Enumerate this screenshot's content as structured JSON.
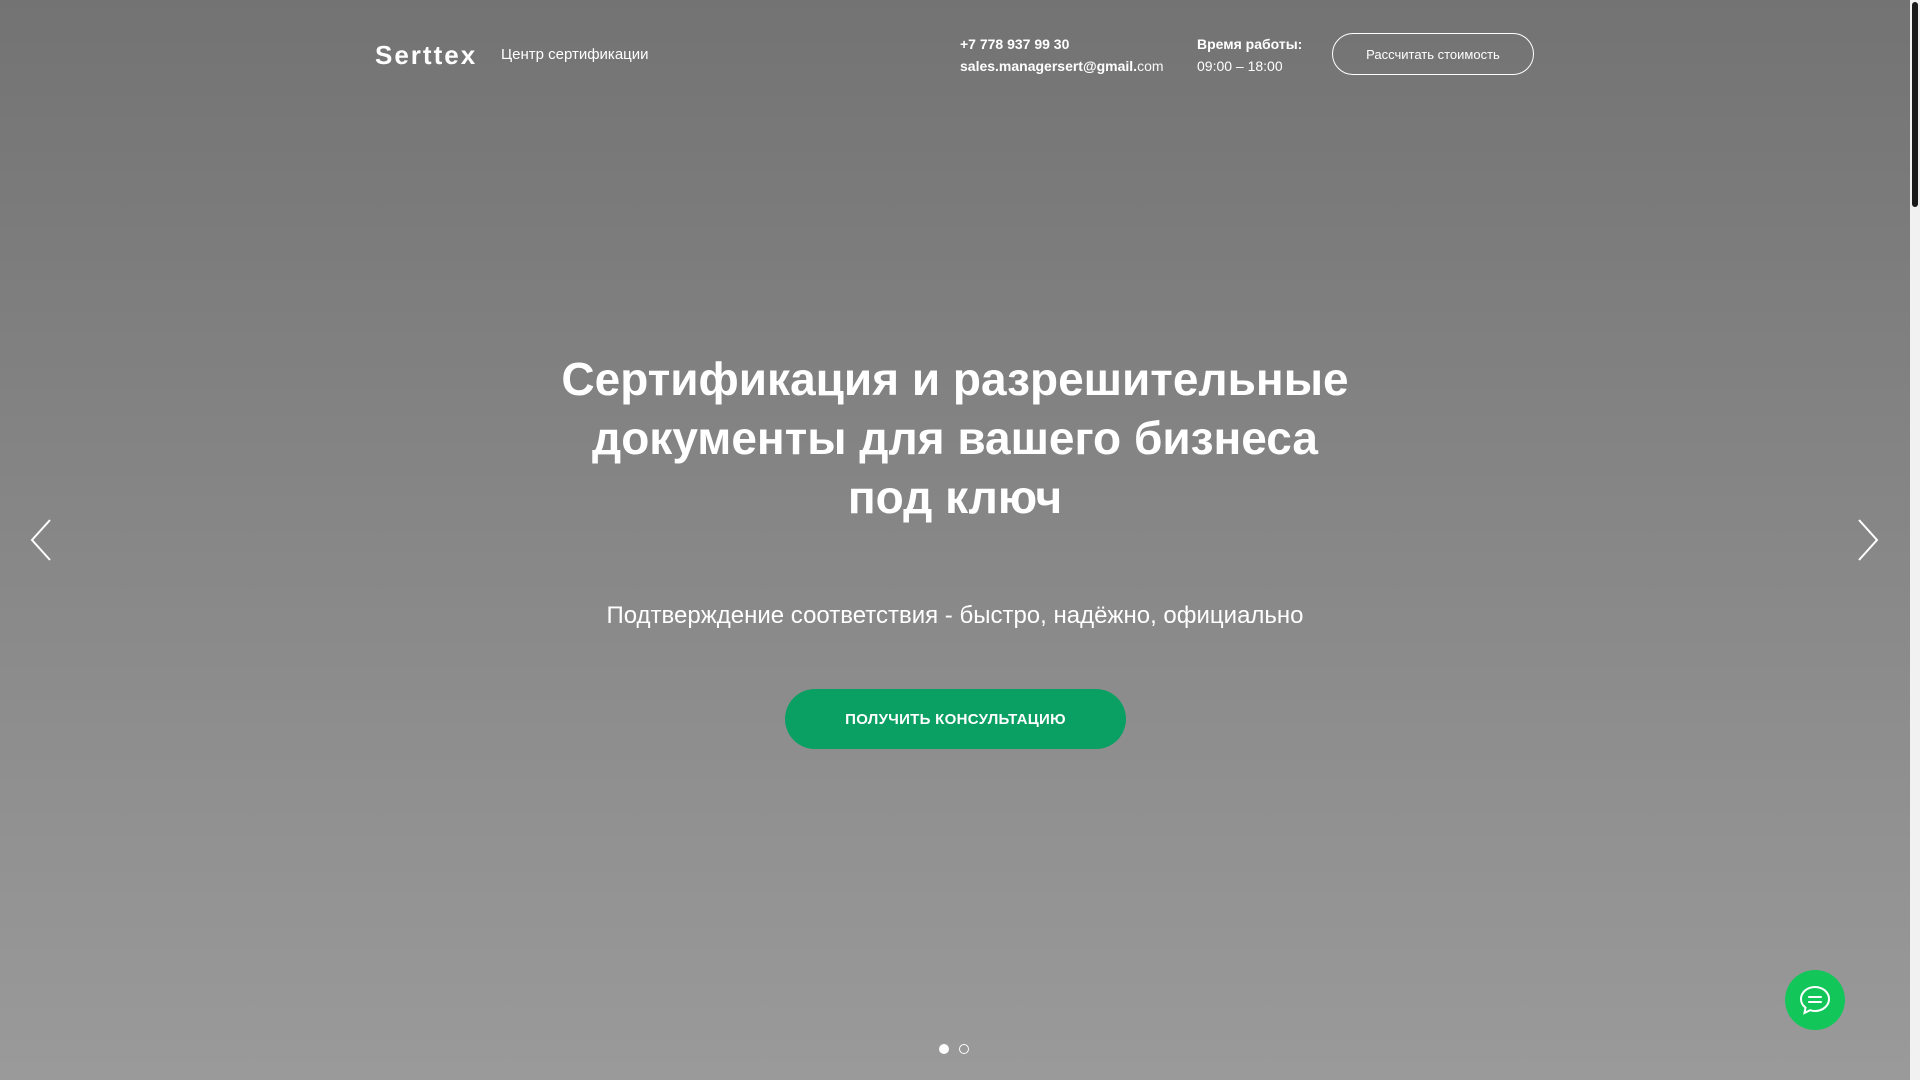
{
  "header": {
    "logo": "Serttex",
    "tagline": "Центр сертификации",
    "phone": "+7 778 937 99 30",
    "email_user": "sales.managersert@gmail.",
    "email_domain": "com",
    "hours_label": "Время работы:",
    "hours_value": "09:00 – 18:00",
    "cta_label": "Рассчитать стоимость"
  },
  "hero": {
    "title_lines": [
      "Сертификация и разрешительные",
      "документы для вашего бизнеса",
      "под ключ"
    ],
    "subtitle": "Подтверждение соответствия - быстро, надёжно, официально",
    "cta_label": "ПОЛУЧИТЬ КОНСУЛЬТАЦИЮ"
  },
  "slider": {
    "prev_icon": "chevron-left-icon",
    "next_icon": "chevron-right-icon",
    "slide_count": 2,
    "active_slide": 1
  },
  "chat": {
    "icon": "chat-bubble-icon",
    "color": "#12c65a"
  },
  "colors": {
    "accent": "#0a9f63",
    "text": "#ffffff"
  }
}
